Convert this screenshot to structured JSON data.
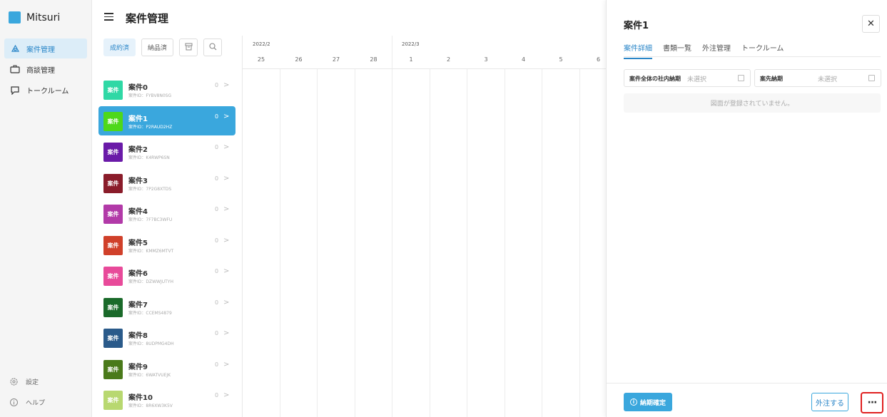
{
  "app": {
    "name": "Mitsuri",
    "brand_color": "#3aa7dd"
  },
  "sidebar": {
    "items": [
      {
        "label": "案件管理",
        "icon": "case-icon",
        "active": true
      },
      {
        "label": "商談管理",
        "icon": "briefcase-icon",
        "active": false
      },
      {
        "label": "トークルーム",
        "icon": "chat-bubble-icon",
        "active": false
      }
    ],
    "bottom": [
      {
        "label": "設定",
        "icon": "gear-icon"
      },
      {
        "label": "ヘルプ",
        "icon": "info-icon"
      }
    ]
  },
  "header": {
    "title": "案件管理"
  },
  "filters": {
    "contracted": "成約済",
    "delivered": "納品済"
  },
  "cases": [
    {
      "name": "案件0",
      "id": "案件ID：FYBV8N0SG",
      "count": "0",
      "badge": "案件",
      "color": "#2fd8a5"
    },
    {
      "name": "案件1",
      "id": "案件ID：P2RAUD2HZ",
      "count": "0",
      "badge": "案件",
      "color": "#4ed81a"
    },
    {
      "name": "案件2",
      "id": "案件ID：K4RWP6SN",
      "count": "0",
      "badge": "案件",
      "color": "#6a1aa8"
    },
    {
      "name": "案件3",
      "id": "案件ID：7P2G8XTDS",
      "count": "0",
      "badge": "案件",
      "color": "#8a1c2a"
    },
    {
      "name": "案件4",
      "id": "案件ID：7F7BC3WFU",
      "count": "0",
      "badge": "案件",
      "color": "#b23aa8"
    },
    {
      "name": "案件5",
      "id": "案件ID：KMMZ6MTVT",
      "count": "0",
      "badge": "案件",
      "color": "#d0402a"
    },
    {
      "name": "案件6",
      "id": "案件ID：DZWWJUTYH",
      "count": "0",
      "badge": "案件",
      "color": "#e84a9a"
    },
    {
      "name": "案件7",
      "id": "案件ID：CCEMS4879",
      "count": "0",
      "badge": "案件",
      "color": "#1a6a2a"
    },
    {
      "name": "案件8",
      "id": "案件ID：8UDPMG4DH",
      "count": "0",
      "badge": "案件",
      "color": "#2a5a8a"
    },
    {
      "name": "案件9",
      "id": "案件ID：6WATVUEJK",
      "count": "0",
      "badge": "案件",
      "color": "#4a7a1a"
    },
    {
      "name": "案件10",
      "id": "案件ID：8R6XW3K5V",
      "count": "0",
      "badge": "案件",
      "color": "#b8d870"
    }
  ],
  "selected_case_index": 1,
  "gantt": {
    "months": [
      "2022/2",
      "2022/3"
    ],
    "days": [
      "25",
      "26",
      "27",
      "28",
      "1",
      "2",
      "3",
      "4",
      "5",
      "6"
    ]
  },
  "panel": {
    "title": "案件1",
    "close": "✕",
    "tabs": [
      "案件詳細",
      "書類一覧",
      "外注管理",
      "トークルーム"
    ],
    "active_tab": 0,
    "fields": [
      {
        "label": "案件全体の社内納期",
        "value": "未選択"
      },
      {
        "label": "案先納期",
        "value": "未選択"
      }
    ],
    "empty_message": "図面が登録されていません。",
    "confirm_button": "納期確定",
    "order_button": "外注する",
    "more_button": "···"
  }
}
